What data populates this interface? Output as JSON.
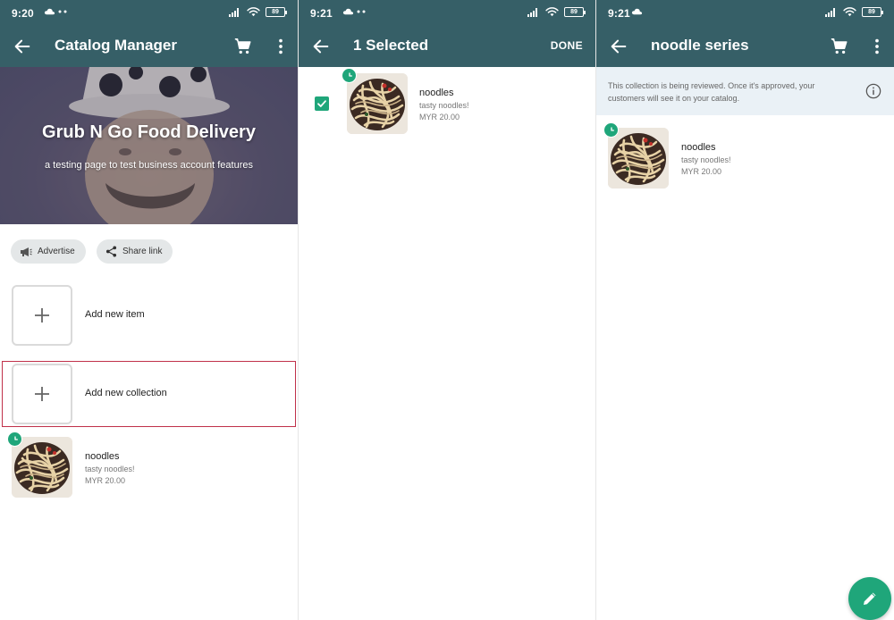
{
  "screens": [
    {
      "status": {
        "time": "9:20",
        "battery": "89"
      },
      "appbar": {
        "title": "Catalog Manager"
      },
      "cover": {
        "business_name": "Grub N Go Food Delivery",
        "business_desc": "a testing page to test business account features"
      },
      "chips": [
        {
          "label": "Advertise",
          "icon": "megaphone-icon"
        },
        {
          "label": "Share link",
          "icon": "share-icon"
        }
      ],
      "add_item": {
        "label": "Add new item"
      },
      "add_collection": {
        "label": "Add new collection"
      },
      "product": {
        "name": "noodles",
        "desc": "tasty noodles!",
        "price": "MYR 20.00"
      }
    },
    {
      "status": {
        "time": "9:21",
        "battery": "89"
      },
      "appbar": {
        "title": "1 Selected",
        "done_label": "DONE"
      },
      "product": {
        "name": "noodles",
        "desc": "tasty noodles!",
        "price": "MYR 20.00"
      }
    },
    {
      "status": {
        "time": "9:21",
        "battery": "89"
      },
      "appbar": {
        "title": "noodle series"
      },
      "banner": {
        "text": "This collection is being reviewed. Once it's approved, your customers will see it on your catalog."
      },
      "product": {
        "name": "noodles",
        "desc": "tasty noodles!",
        "price": "MYR 20.00"
      }
    }
  ],
  "colors": {
    "appbar": "#365f67",
    "accent_green": "#1fa67a",
    "highlight_border": "#c0314a",
    "banner_bg": "#eaf1f6"
  }
}
